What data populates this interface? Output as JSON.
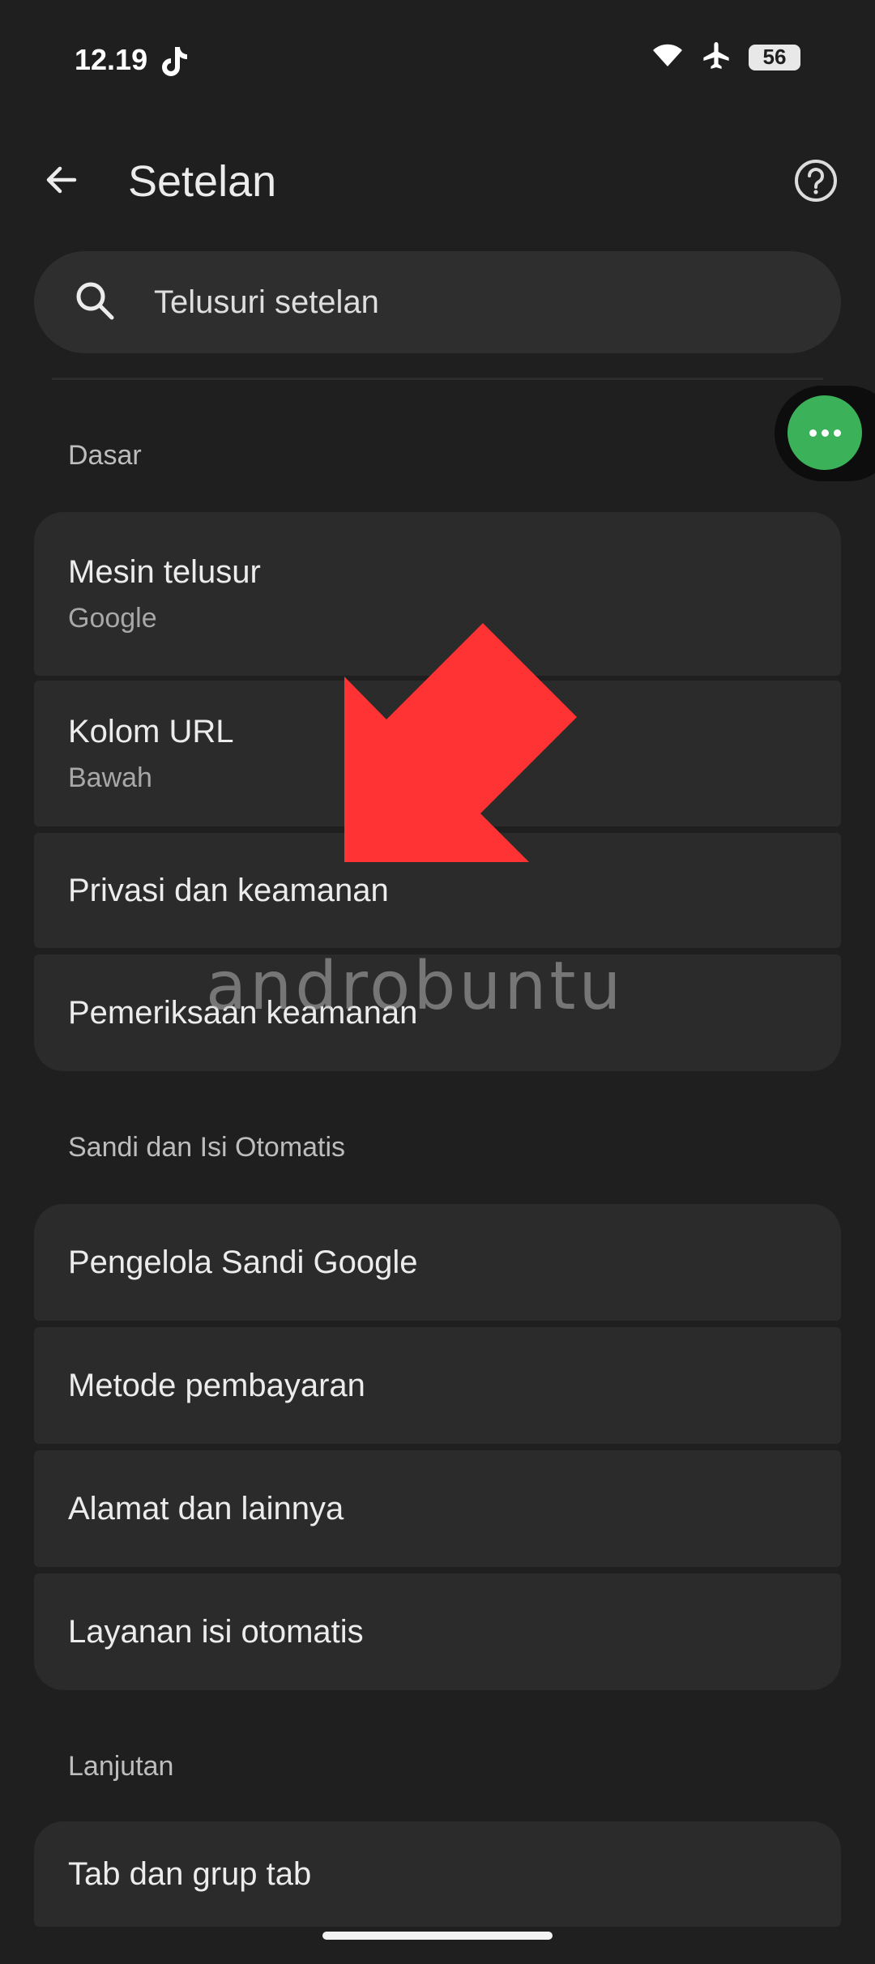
{
  "status_bar": {
    "time": "12.19",
    "battery": "56",
    "icons": [
      "tiktok-icon",
      "wifi-icon",
      "airplane-icon",
      "battery-icon"
    ]
  },
  "app_bar": {
    "title": "Setelan",
    "back_icon": "arrow-back-icon",
    "help_icon": "help-circle-icon"
  },
  "search": {
    "placeholder": "Telusuri setelan"
  },
  "floating_bubble": {
    "icon": "more-horiz-icon",
    "color": "#3bb15a"
  },
  "sections": [
    {
      "header": "Dasar",
      "items": [
        {
          "title": "Mesin telusur",
          "subtitle": "Google"
        },
        {
          "title": "Kolom URL",
          "subtitle": "Bawah"
        },
        {
          "title": "Privasi dan keamanan"
        },
        {
          "title": "Pemeriksaan keamanan"
        }
      ]
    },
    {
      "header": "Sandi dan Isi Otomatis",
      "items": [
        {
          "title": "Pengelola Sandi Google"
        },
        {
          "title": "Metode pembayaran"
        },
        {
          "title": "Alamat dan lainnya"
        },
        {
          "title": "Layanan isi otomatis"
        }
      ]
    },
    {
      "header": "Lanjutan",
      "items": [
        {
          "title": "Tab dan grup tab"
        }
      ]
    }
  ],
  "annotation": {
    "arrow_color": "#ff3333"
  },
  "watermark": "androbuntu"
}
